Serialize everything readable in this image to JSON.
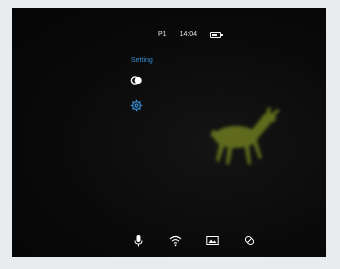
{
  "status_bar": {
    "profile": "P1",
    "time": "14:04",
    "battery_level": 0.6
  },
  "menu": {
    "title": "Setting",
    "items": [
      {
        "icon": "toggle-circles-icon"
      },
      {
        "icon": "gear-icon",
        "active": true
      }
    ]
  },
  "bottom_bar": {
    "icons": [
      "microphone-icon",
      "wifi-icon",
      "image-mode-icon",
      "brightness-icon"
    ]
  },
  "colors": {
    "accent": "#3b8fd6",
    "text": "#e8e8e8",
    "background": "#0a0a0a",
    "thermal_target": "#5f6a1c"
  }
}
